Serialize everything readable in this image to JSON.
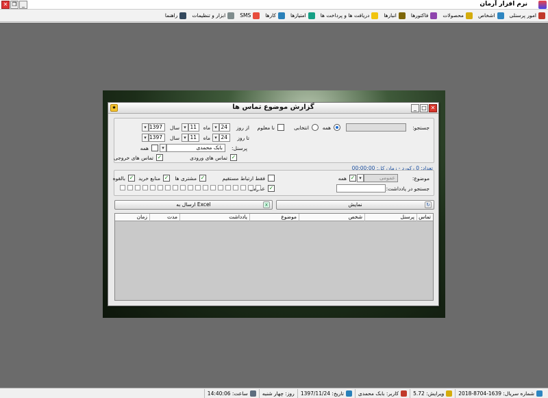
{
  "app": {
    "title": "نرم افزار آرمان"
  },
  "menu": [
    {
      "label": "امور پرسنلی",
      "icon": "staff-icon",
      "color": "#c0392b"
    },
    {
      "label": "اشخاص",
      "icon": "people-icon",
      "color": "#2e86c1"
    },
    {
      "label": "محصولات",
      "icon": "products-icon",
      "color": "#d4ac0d"
    },
    {
      "label": "فاکتورها",
      "icon": "invoices-icon",
      "color": "#8e44ad"
    },
    {
      "label": "انبارها",
      "icon": "warehouse-icon",
      "color": "#7d6608"
    },
    {
      "label": "دریافت ها و پرداخت ها",
      "icon": "payments-icon",
      "color": "#f1c40f"
    },
    {
      "label": "امتیازها",
      "icon": "points-icon",
      "color": "#16a085"
    },
    {
      "label": "کارها",
      "icon": "tasks-icon",
      "color": "#2980b9"
    },
    {
      "label": "SMS",
      "icon": "sms-icon",
      "color": "#e74c3c"
    },
    {
      "label": "ابزار و تنظیمات",
      "icon": "tools-icon",
      "color": "#7f8c8d"
    },
    {
      "label": "راهنما",
      "icon": "help-icon",
      "color": "#34495e"
    }
  ],
  "dialog": {
    "title": "گزارش موضوع تماس ها",
    "search_label": "جستجو:",
    "search_value": "",
    "radio_all": "همه",
    "radio_select": "انتخابی",
    "unknown_label": "نا معلوم",
    "from_label": "از روز",
    "to_label": "تا روز",
    "from": {
      "day": "24",
      "month": "11",
      "year": "1397"
    },
    "to": {
      "day": "24",
      "month": "11",
      "year": "1397"
    },
    "month_label": "ماه",
    "year_label": "سال",
    "personnel_label": "پرسنل:",
    "personnel_value": "بابک محمدی",
    "all_label": "همه",
    "incoming_label": "تماس های ورودی",
    "outgoing_label": "تماس های خروجی",
    "count_text": "تعداد: 0 رکورد - زمان کل: 00:00:00",
    "subject_label": "موضوع:",
    "subject_value": "عمومی",
    "subject_all": "همه",
    "direct_only": "فقط ارتباط مستقیم",
    "customers": "مشتری ها",
    "purchase_sources": "منابع خرید",
    "potential": "بالقوه",
    "general": "عمومی",
    "note_search_label": "جستجو در یادداشت:",
    "show_button": "نمایش",
    "excel_button": "ارسال به Excel",
    "columns": [
      "تماس",
      "پرسنل",
      "شخص",
      "موضوع",
      "یادداشت",
      "مدت",
      "زمان"
    ]
  },
  "status": [
    {
      "label": "شماره سریال: 1639-8704-2018",
      "icon": "serial-icon",
      "color": "#2e86c1"
    },
    {
      "label": "ویرایش: 5.72",
      "icon": "edit-icon",
      "color": "#d4ac0d"
    },
    {
      "label": "کاربر: بابک محمدی",
      "icon": "user-icon",
      "color": "#c0392b"
    },
    {
      "label": "تاریخ: 1397/11/24",
      "icon": "calendar-icon",
      "color": "#2980b9"
    },
    {
      "label": "روز: چهار شنبه",
      "icon": "",
      "color": ""
    },
    {
      "label": "ساعت: 14:40:06",
      "icon": "clock-icon",
      "color": "#5d6d7e"
    }
  ]
}
